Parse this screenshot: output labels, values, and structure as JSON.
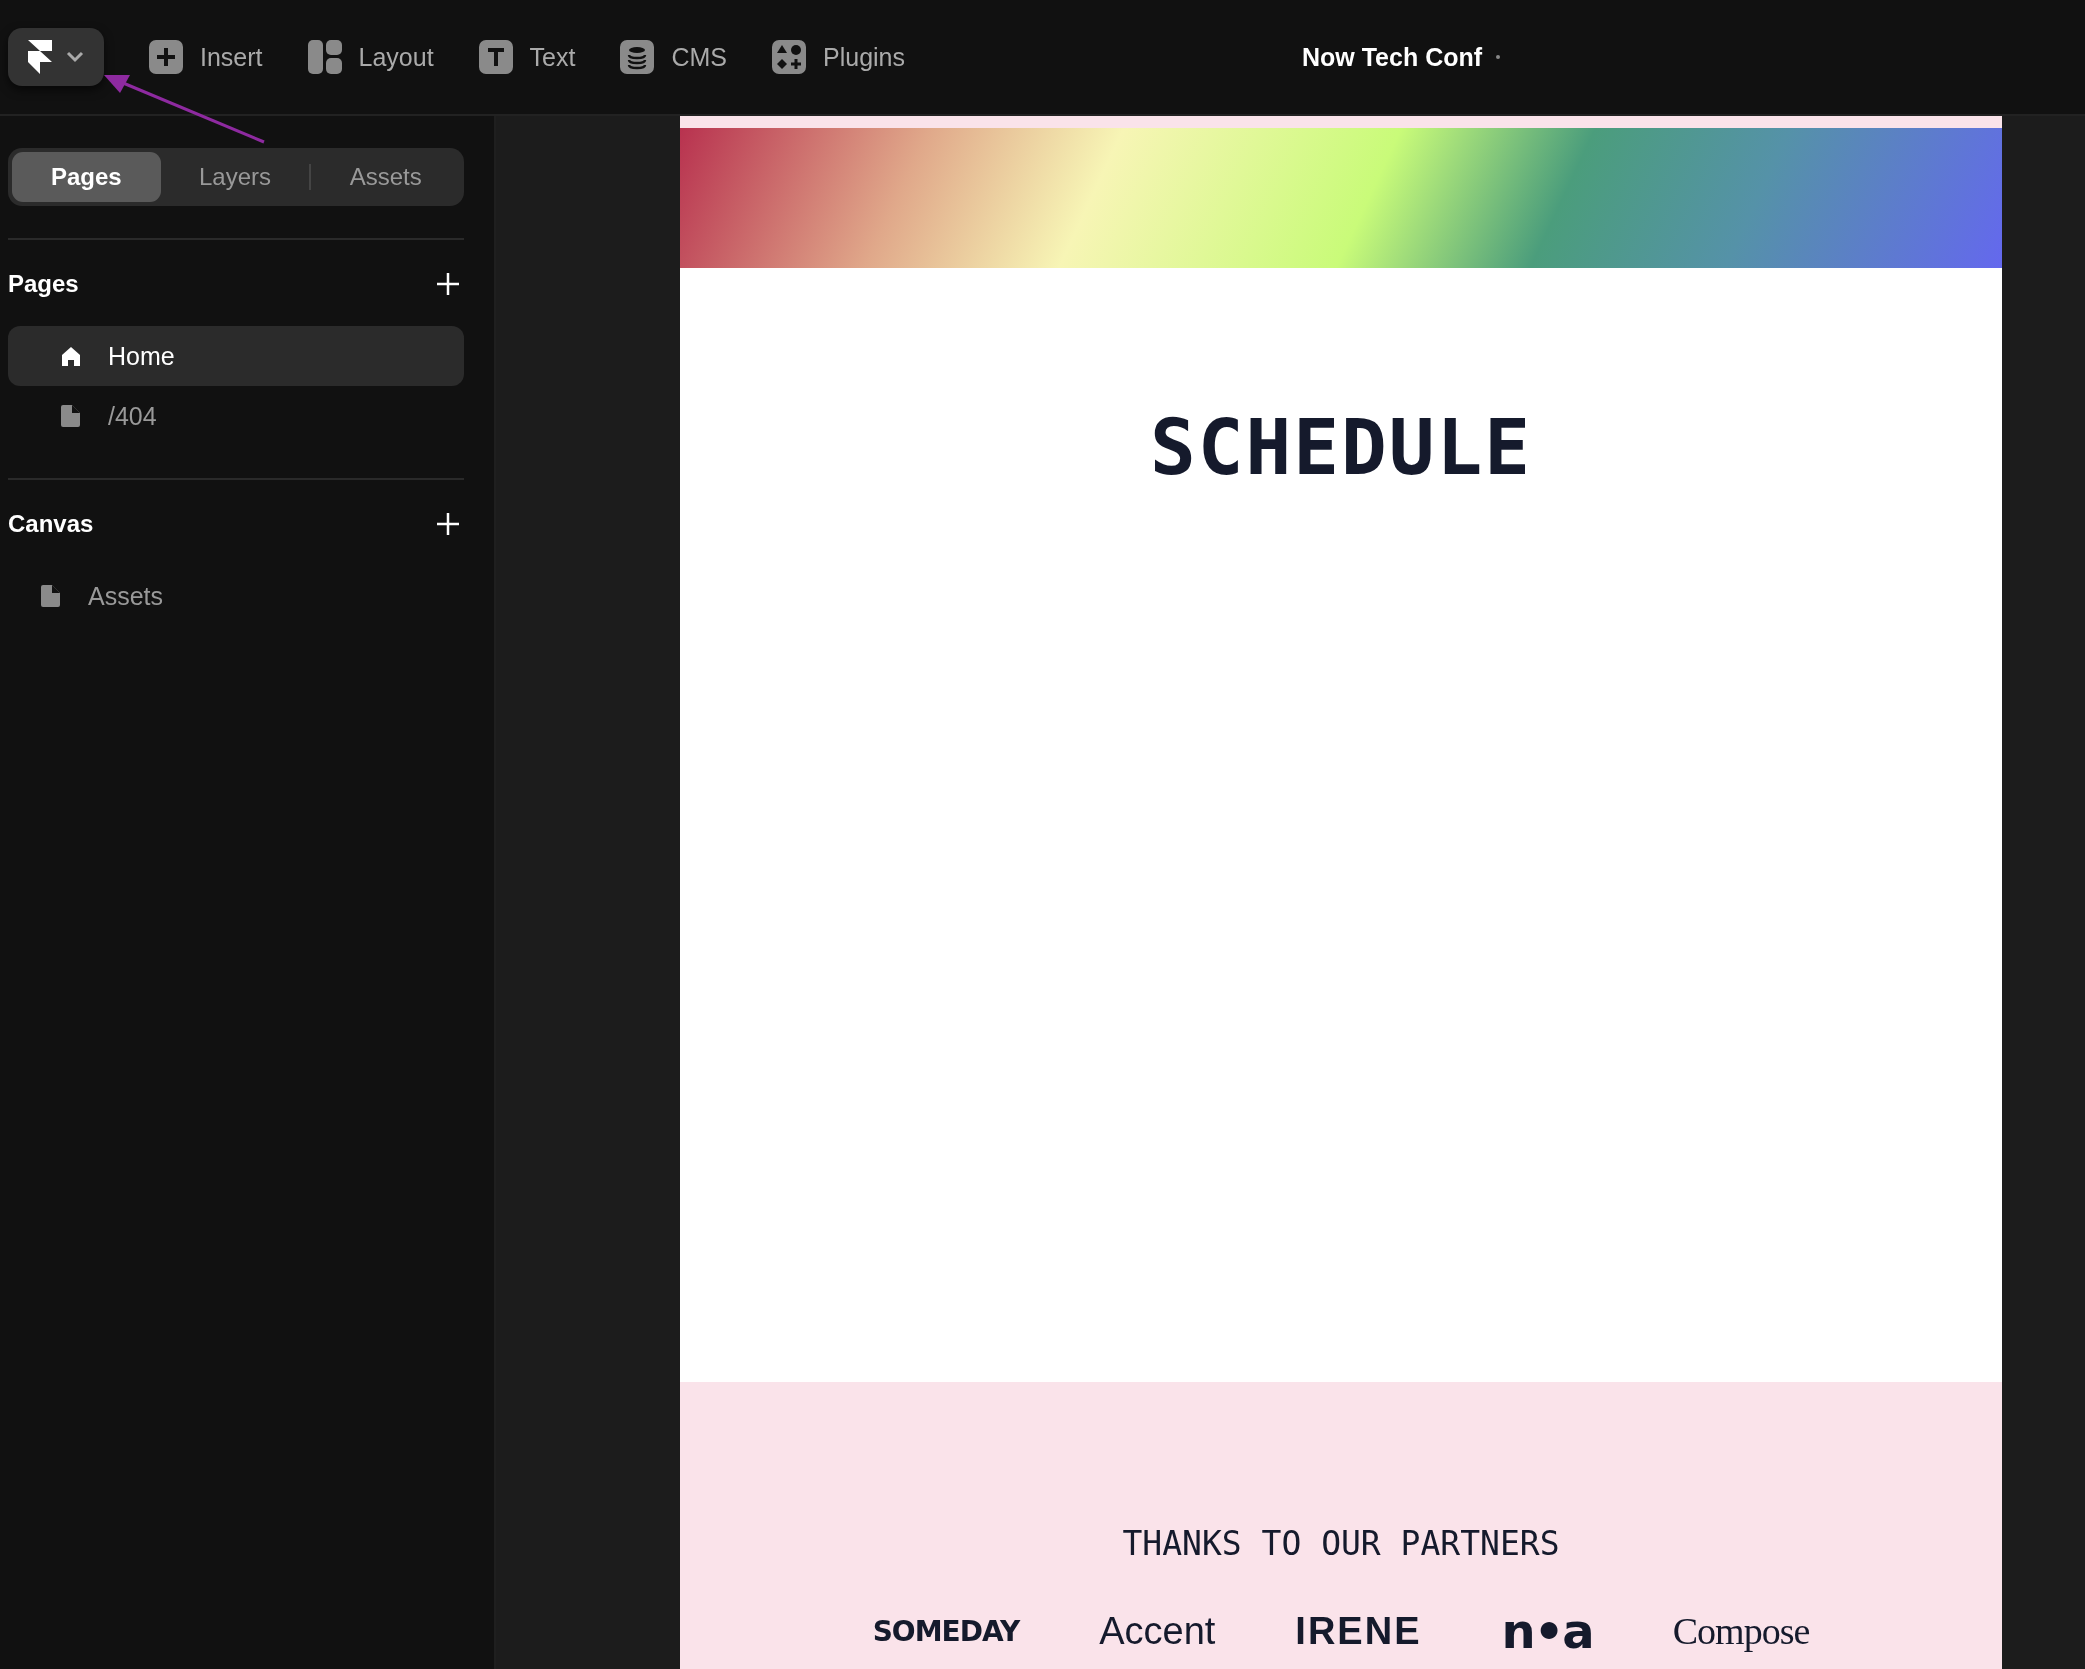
{
  "toolbar": {
    "items": [
      {
        "kind": "insert",
        "label": "Insert"
      },
      {
        "kind": "layout",
        "label": "Layout"
      },
      {
        "kind": "text",
        "label": "Text"
      },
      {
        "kind": "cms",
        "label": "CMS"
      },
      {
        "kind": "plugins",
        "label": "Plugins"
      }
    ],
    "project_title": "Now Tech Conf"
  },
  "sidebar": {
    "tabs": [
      {
        "label": "Pages",
        "selected": true
      },
      {
        "label": "Layers",
        "selected": false
      },
      {
        "label": "Assets",
        "selected": false
      }
    ],
    "sections": [
      {
        "title": "Pages",
        "items": [
          {
            "kind": "home",
            "label": "Home",
            "selected": true
          },
          {
            "kind": "page",
            "label": "/404",
            "selected": false
          }
        ]
      },
      {
        "title": "Canvas",
        "items": [
          {
            "kind": "page",
            "label": "Assets",
            "selected": false
          }
        ]
      }
    ]
  },
  "canvas": {
    "heading": "SCHEDULE",
    "partners_heading": "THANKS TO OUR PARTNERS",
    "partners": [
      {
        "kind": "heavy",
        "label": "SOMEDAY"
      },
      {
        "kind": "sans",
        "label": "Accent"
      },
      {
        "kind": "wide",
        "label": "IRENE"
      },
      {
        "kind": "black",
        "label": "n•a"
      },
      {
        "kind": "serif",
        "label": "Compose"
      }
    ]
  }
}
